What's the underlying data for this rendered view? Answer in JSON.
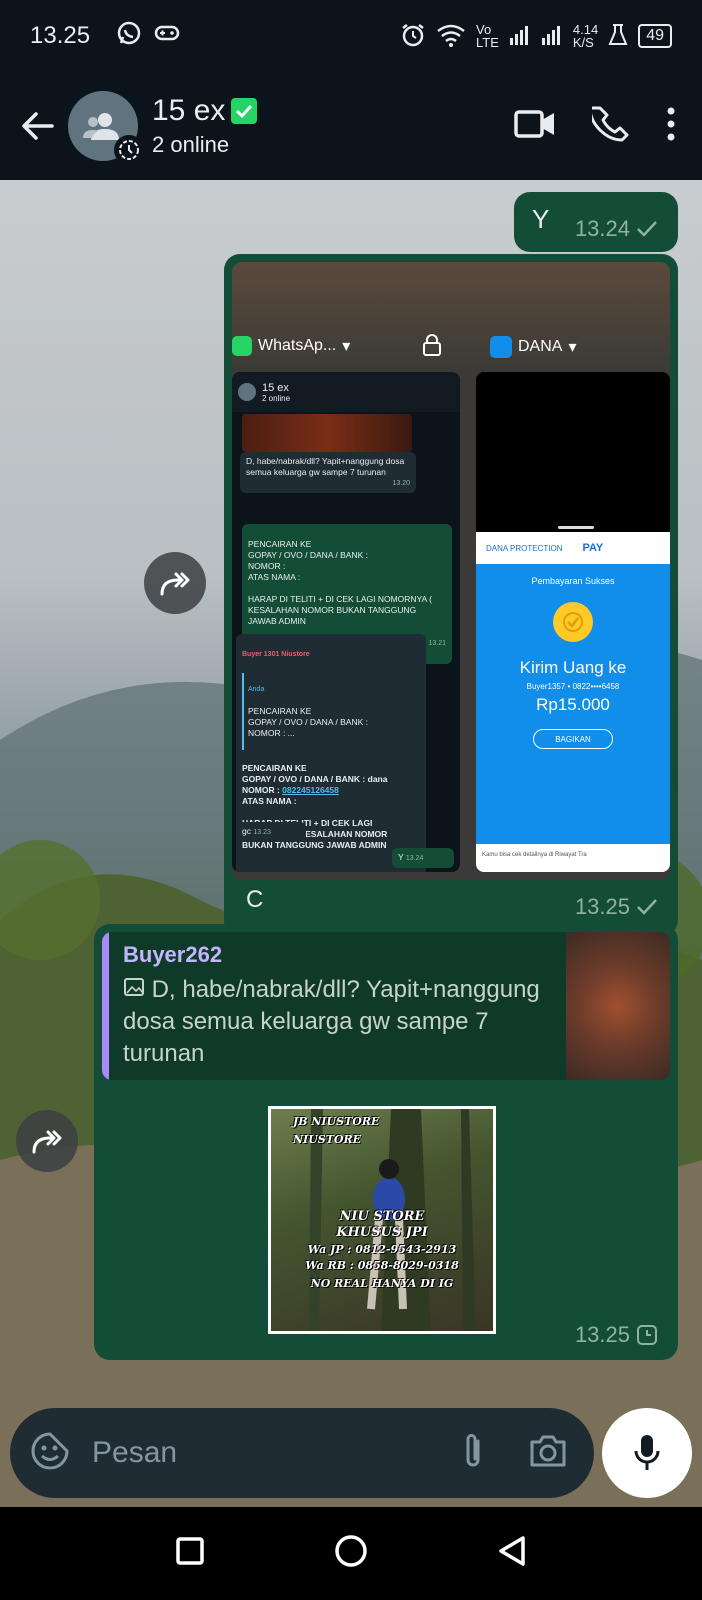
{
  "status": {
    "time": "13.25",
    "network_top": "Vo",
    "network_bottom": "LTE",
    "speed_top": "4.14",
    "speed_bottom": "K/S",
    "battery": "49"
  },
  "header": {
    "title": "15 ex",
    "subtitle": "2 online"
  },
  "messages": {
    "y": {
      "text": "Y",
      "time": "13.24"
    },
    "image": {
      "caption": "C",
      "time": "13.25",
      "screenshot": {
        "tab_whatsapp": "WhatsAp...",
        "tab_dana": "DANA",
        "mini_title": "15 ex",
        "mini_sub": "2 online",
        "b1": "D, habe/nabrak/dll? Yapit+nanggung dosa semua keluarga gw sampe 7 turunan",
        "b1_time": "13.20",
        "b2": "PENCAIRAN KE\n GOPAY / OVO / DANA / BANK :\n NOMOR :\n ATAS NAMA :\n\n HARAP DI TELITI + DI CEK LAGI NOMORNYA ( KESALAHAN NOMOR BUKAN TANGGUNG JAWAB ADMIN",
        "b2_time": "13.21",
        "b3_sender": "Buyer 1301 Niustore",
        "b3_quote_who": "Anda",
        "b3_quote": "PENCAIRAN KE\n GOPAY / OVO / DANA / BANK :\n NOMOR : ...",
        "b3_a": "PENCAIRAN KE\n GOPAY / OVO / DANA / BANK : dana\nNOMOR : ",
        "b3_number": "082245126458",
        "b3_b": "\nATAS NAMA :\n\nHARAP DI TELITI + DI CEK LAGI NOMORNYA ( KESALAHAN NOMOR BUKAN TANGGUNG JAWAB ADMIN",
        "b3_time": "13.23",
        "b4": "gc",
        "b4_time": "13.23",
        "b5": "Y",
        "b5_time": "13.24",
        "dana_protection": "DANA PROTECTION",
        "dana_pay": "PAY",
        "dana_status": "Pembayaran Sukses",
        "dana_title": "Kirim Uang ke",
        "dana_recipient": "Buyer1357 • 0822••••6458",
        "dana_amount": "Rp15.000",
        "dana_share": "BAGIKAN",
        "dana_footer": "Kamu bisa cek detailnya di Riwayat Tra"
      }
    },
    "quoted": {
      "sender": "Buyer262",
      "quote": "D, habe/nabrak/dll? Yapit+nanggung dosa semua keluarga gw sampe 7 turunan",
      "time": "13.25",
      "sticker": {
        "line1": "JB NIUSTORE",
        "line2": "NIUSTORE",
        "line3": "NIU STORE",
        "line4": "KHUSUS JPI",
        "line5": "Wa JP : 0812-9543-2913",
        "line6": "Wa RB : 0858-8029-0318",
        "line7": "NO REAL HANYA DI IG"
      }
    }
  },
  "input": {
    "placeholder": "Pesan"
  },
  "colors": {
    "bubble": "#144d37",
    "header": "#0b141a",
    "accent": "#25d366"
  }
}
